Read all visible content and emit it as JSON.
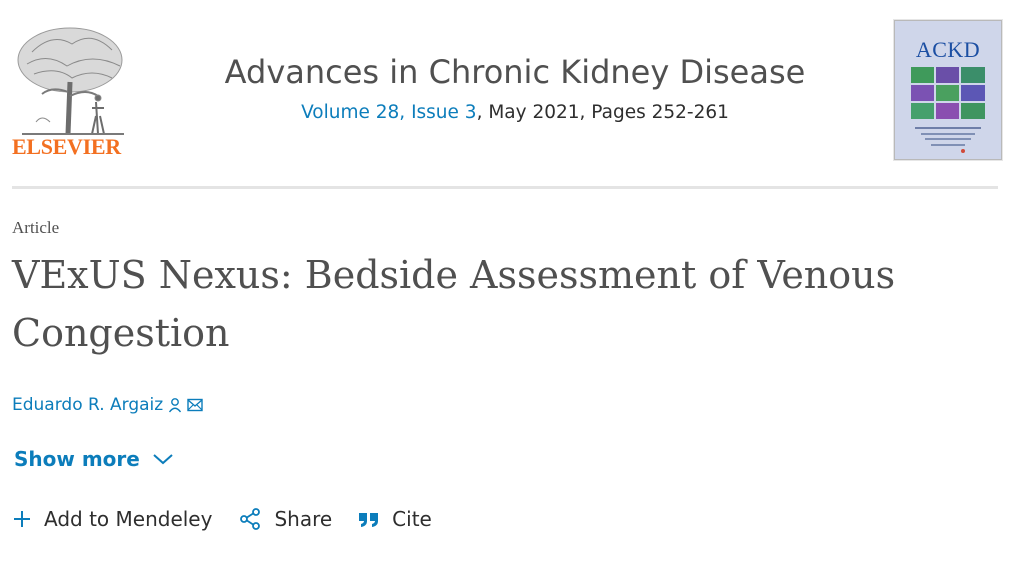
{
  "publisher": {
    "name": "ELSEVIER"
  },
  "journal": {
    "title": "Advances in Chronic Kidney Disease",
    "volume": "Volume 28, Issue 3",
    "issue_rest": ", May 2021, Pages 252-261",
    "cover_abbrev": "ACKD"
  },
  "article": {
    "type": "Article",
    "title": "VExUS Nexus: Bedside Assessment of Venous Congestion",
    "authors": [
      {
        "name": "Eduardo R. Argaiz"
      }
    ]
  },
  "show_more_label": "Show more",
  "actions": {
    "add": "Add to Mendeley",
    "share": "Share",
    "cite": "Cite"
  },
  "colors": {
    "link": "#0c7dbb",
    "brand": "#f37021",
    "text": "#505050"
  },
  "icons": {
    "author": "person-icon",
    "email": "envelope-icon",
    "show_more": "chevron-down-icon",
    "add": "plus-icon",
    "share": "share-icon",
    "cite": "quote-icon"
  }
}
